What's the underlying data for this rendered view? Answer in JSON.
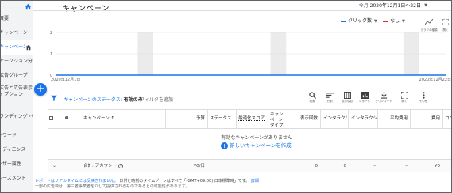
{
  "sidebar": {
    "items": [
      {
        "label": "概要",
        "active": false
      },
      {
        "label": "キャンペーン",
        "active": false
      },
      {
        "label": "キャンペーン",
        "active": true
      },
      {
        "label": "オークション分析",
        "active": false
      },
      {
        "label": "広告グループ",
        "active": false
      },
      {
        "label": "広告と広告表示オプション",
        "active": false
      },
      {
        "label": "ランディング ページ",
        "active": false
      },
      {
        "label": "キーワード",
        "active": false
      },
      {
        "label": "オーディエンス",
        "active": false
      },
      {
        "label": "ユーザー属性",
        "active": false
      },
      {
        "label": "プレースメント",
        "active": false
      }
    ]
  },
  "header": {
    "title": "キャンペーン",
    "date_prefix": "今月",
    "date_range": "2020年12月1日～22日"
  },
  "chart_controls": {
    "metric1": "クリック数",
    "metric1_color": "#1a73e8",
    "metric2": "なし",
    "metric2_color": "#d93025",
    "graph_type_label": "グラフの種類",
    "expand_label": "開く"
  },
  "chart_data": {
    "type": "line",
    "title": "",
    "xlabel": "",
    "ylabel": "",
    "x": [
      "2020年12月1日",
      "2020年12月22日"
    ],
    "series": [
      {
        "values": [
          0,
          0
        ]
      }
    ],
    "yticks": [
      "2",
      "1",
      "0"
    ],
    "ylim": [
      0,
      2
    ],
    "shaded_weekends": true,
    "grid": true
  },
  "filter": {
    "prefix": "キャンペーンのステータス: ",
    "value": "有効のみ",
    "add_label": "フィルタを追加"
  },
  "toolbar": [
    {
      "label": "検索",
      "icon": "search-icon"
    },
    {
      "label": "分割",
      "icon": "segment-icon"
    },
    {
      "label": "表示項目",
      "icon": "columns-icon"
    },
    {
      "label": "レポート",
      "icon": "report-icon"
    },
    {
      "label": "ダウンロード",
      "icon": "download-icon"
    },
    {
      "label": "開く",
      "icon": "expand-icon"
    },
    {
      "label": "その他",
      "icon": "more-icon"
    }
  ],
  "table": {
    "columns": [
      "キャンペーン",
      "予算",
      "ステータス",
      "最適化スコア",
      "キャンペーンタイプ",
      "表示回数",
      "インタラクション",
      "インタラクション率",
      "平均費用",
      "費用",
      "コンバージョン"
    ],
    "empty_message": "有効なキャンペーンがありません",
    "create_label": "新しいキャンペーンを作成",
    "total": {
      "label": "合計: アカウント",
      "budget": "¥0/日",
      "impressions": "0",
      "interactions": "0",
      "interaction_rate": "–",
      "avg_cost": "–",
      "cost": "¥0"
    }
  },
  "footer": {
    "line1_link": "レポートはリアルタイムには反映されません。",
    "line1_text": "日付と時刻のタイムゾーンはすべて「(GMT+09:00) 日本標準時」です。",
    "line1_detail": "詳細",
    "line2": "一部の広告枠は、第三者事業者を介して提供されるものであるとの可能性があります。"
  }
}
